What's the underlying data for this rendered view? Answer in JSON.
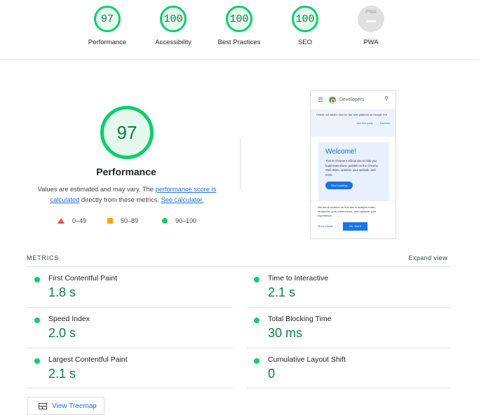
{
  "gauges": [
    {
      "score": "97",
      "label": "Performance"
    },
    {
      "score": "100",
      "label": "Accessibility"
    },
    {
      "score": "100",
      "label": "Best Practices"
    },
    {
      "score": "100",
      "label": "SEO"
    },
    {
      "score": "PWA",
      "label": "PWA"
    }
  ],
  "colors": {
    "pass": "#0cce6b",
    "pass_text": "#0b8043",
    "average": "#ffa400",
    "fail": "#ff4e42",
    "link": "#1a73e8"
  },
  "performance": {
    "score": "97",
    "title": "Performance",
    "desc_1": "Values are estimated and may vary. The ",
    "desc_link_1": "performance score is calculated",
    "desc_2": " directly from these metrics. ",
    "desc_link_2": "See calculator."
  },
  "legend": [
    {
      "shape": "triangle-icon",
      "range": "0–49"
    },
    {
      "shape": "square-icon",
      "range": "50–89"
    },
    {
      "shape": "circle-icon",
      "range": "90–100"
    }
  ],
  "thumbnail": {
    "brand": "Developers",
    "banner": "Check out what's new for the web platform at Google I/O!",
    "banner_link_1": "Join the party",
    "banner_link_2": "Dismiss",
    "welcome_title": "Welcome!",
    "welcome_text": "This is Chrome's official site to help you build Extensions, publish on the Chrome Web Store, optimize your website, and more.",
    "welcome_button": "Start building",
    "cookie_text": "We serve cookies on this site to analyze traffic, remember your preferences, and optimize your experience.",
    "cookie_more": "More details",
    "cookie_ok": "Ok, Got it"
  },
  "metrics": {
    "title": "METRICS",
    "expand": "Expand view",
    "items": [
      {
        "name": "First Contentful Paint",
        "value": "1.8 s"
      },
      {
        "name": "Time to Interactive",
        "value": "2.1 s"
      },
      {
        "name": "Speed Index",
        "value": "2.0 s"
      },
      {
        "name": "Total Blocking Time",
        "value": "30 ms"
      },
      {
        "name": "Largest Contentful Paint",
        "value": "2.1 s"
      },
      {
        "name": "Cumulative Layout Shift",
        "value": "0"
      }
    ]
  },
  "treemap_label": "View Treemap"
}
